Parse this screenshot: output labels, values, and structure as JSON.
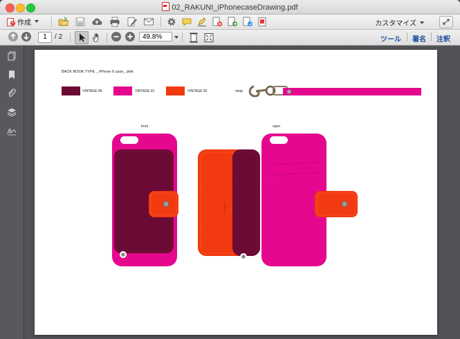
{
  "window": {
    "title": "02_RAKUNI_iPhonecaseDrawing.pdf"
  },
  "toolbar": {
    "create_label": "作成",
    "customize_label": "カスタマイズ"
  },
  "nav": {
    "page_current": "1",
    "page_total": "/ 2",
    "zoom": "49.8%"
  },
  "right_links": {
    "tools": "ツール",
    "sign": "署名",
    "comment": "注釈"
  },
  "document": {
    "title": "BACK BOOK TYPE _ iPhone 6 case_ pink",
    "swatches": [
      {
        "label": "VINTAGE 80",
        "color": "#6b0a35"
      },
      {
        "label": "VINTAGE 81",
        "color": "#e5088e"
      },
      {
        "label": "VINTAGE 82",
        "color": "#f23a10"
      }
    ],
    "strap_label": "strap",
    "front_label": "front",
    "open_label": "open",
    "brand_mark": "RAKUNI",
    "colors": {
      "plum": "#6b0a35",
      "pink": "#e5088e",
      "orange": "#f23a10"
    }
  },
  "icons": {
    "toolbar": [
      "open-folder-icon",
      "save-icon",
      "cloud-upload-icon",
      "print-icon",
      "edit-icon",
      "mail-icon",
      "gear-icon",
      "comment-icon",
      "highlight-icon",
      "delete-page-icon",
      "export-page-icon",
      "rotate-page-icon",
      "organize-icon"
    ],
    "sidebar": [
      "pages-icon",
      "bookmark-icon",
      "attachment-icon",
      "layers-icon",
      "signature-icon"
    ]
  }
}
